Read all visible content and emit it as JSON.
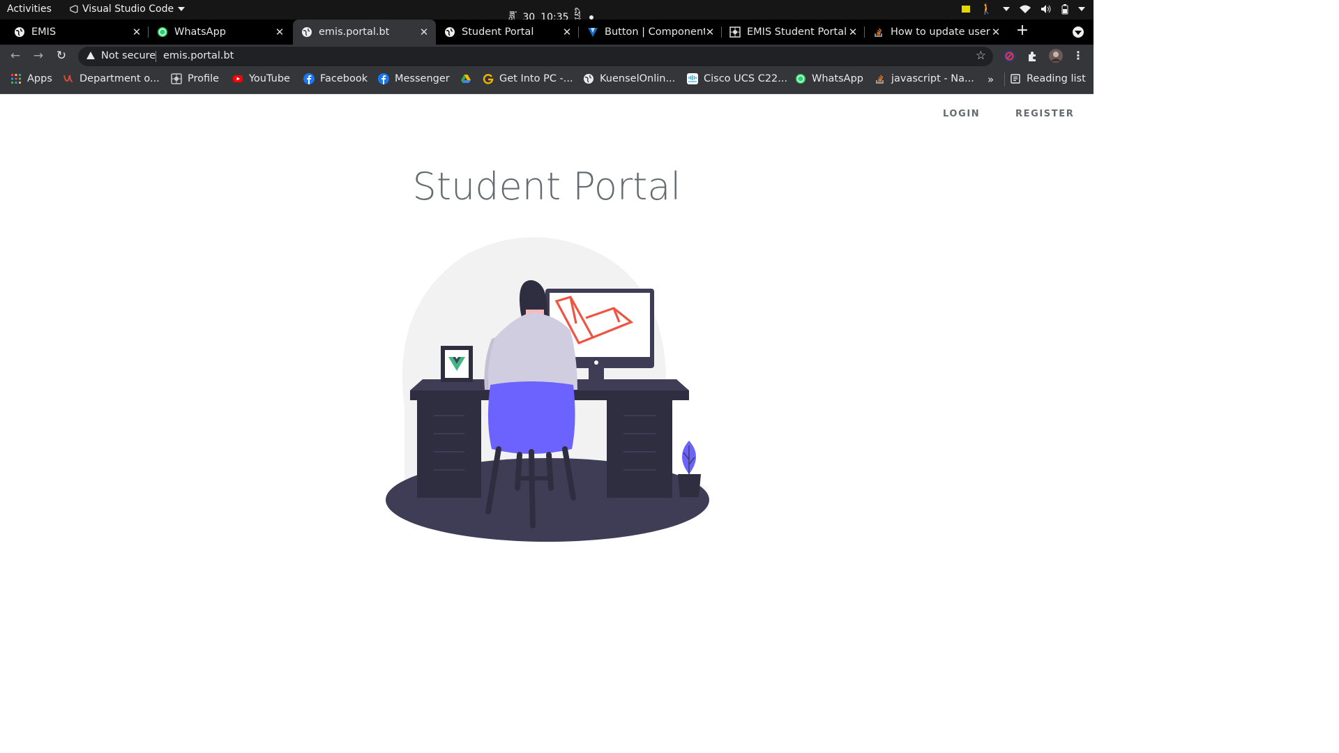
{
  "system_bar": {
    "activities": "Activities",
    "app_name": "Visual Studio Code",
    "date": "30",
    "time": "10:35",
    "time_suffix": "ཕྱི"
  },
  "tabs": [
    {
      "title": "EMIS",
      "icon": "globe-icon",
      "active": false
    },
    {
      "title": "WhatsApp",
      "icon": "whatsapp-icon",
      "active": false
    },
    {
      "title": "emis.portal.bt",
      "icon": "globe-icon",
      "active": true
    },
    {
      "title": "Student Portal",
      "icon": "globe-icon",
      "active": false
    },
    {
      "title": "Button | Component",
      "icon": "vuetify-icon",
      "active": false
    },
    {
      "title": "EMIS Student Portal",
      "icon": "grid-logo-icon",
      "active": false
    },
    {
      "title": "How to update user",
      "icon": "stackoverflow-icon",
      "active": false
    }
  ],
  "address_bar": {
    "security": "Not secure",
    "url": "emis.portal.bt"
  },
  "bookmarks": [
    {
      "label": "Apps",
      "icon": "apps-grid-icon",
      "color": "#e8453c"
    },
    {
      "label": "Department o...",
      "icon": "department-icon",
      "color": "#d84b3b"
    },
    {
      "label": "Profile",
      "icon": "grid-logo-icon",
      "color": "#cccccc"
    },
    {
      "label": "YouTube",
      "icon": "youtube-icon",
      "color": "#ff0000"
    },
    {
      "label": "Facebook",
      "icon": "facebook-icon",
      "color": "#1877f2"
    },
    {
      "label": "Messenger",
      "icon": "facebook-icon",
      "color": "#1877f2"
    },
    {
      "label": "",
      "icon": "google-drive-icon",
      "color": "#34a853"
    },
    {
      "label": "Get Into PC -...",
      "icon": "getintopc-icon",
      "color": "#f4b400"
    },
    {
      "label": "KuenselOnlin...",
      "icon": "globe-icon",
      "color": "#cccccc"
    },
    {
      "label": "Cisco UCS C22...",
      "icon": "cisco-icon",
      "color": "#049fd9"
    },
    {
      "label": "WhatsApp",
      "icon": "whatsapp-icon",
      "color": "#25d366"
    },
    {
      "label": "javascript - Na...",
      "icon": "stackoverflow-icon",
      "color": "#f48024"
    }
  ],
  "bookmarks_overflow": "»",
  "reading_list": "Reading list",
  "page": {
    "nav": {
      "login": "LOGIN",
      "register": "REGISTER"
    },
    "title": "Student Portal"
  },
  "colors": {
    "laravel": "#f05340",
    "vue_green": "#41b883",
    "chair": "#6c63ff",
    "desk": "#2f2e41",
    "backdrop": "#f2f2f2"
  }
}
